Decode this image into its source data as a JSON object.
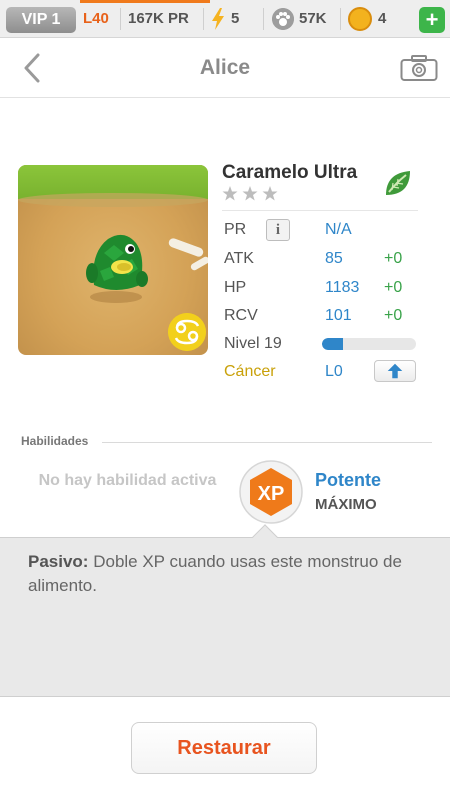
{
  "status_bar": {
    "vip": "VIP 1",
    "level": "L40",
    "power": "167K PR",
    "energy": "5",
    "food": "57K",
    "coins": "4",
    "add_label": "+"
  },
  "nav": {
    "title": "Alice"
  },
  "monster": {
    "name": "Caramelo Ultra",
    "star_count": 3,
    "element": "leaf-icon",
    "stats": [
      {
        "label": "PR",
        "value": "N/A",
        "bonus": ""
      },
      {
        "label": "ATK",
        "value": "85",
        "bonus": "+0"
      },
      {
        "label": "HP",
        "value": "1183",
        "bonus": "+0"
      },
      {
        "label": "RCV",
        "value": "101",
        "bonus": "+0"
      }
    ],
    "info_label": "i",
    "level_label": "Nivel 19",
    "level_progress": 0.22,
    "sign_label": "Cáncer",
    "sign_level": "L0"
  },
  "skills": {
    "header": "Habilidades",
    "no_active": "No hay habilidad activa",
    "badge": "XP",
    "name": "Potente",
    "level": "MÁXIMO"
  },
  "passive": {
    "label": "Pasivo:",
    "text": " Doble XP cuando usas este monstruo de alimento."
  },
  "footer": {
    "restore_label": "Restaurar"
  },
  "colors": {
    "accent_blue": "#2f86c9",
    "accent_orange": "#e8541f",
    "bonus_green": "#3aa34a",
    "zodiac_gold": "#c9a10a"
  }
}
